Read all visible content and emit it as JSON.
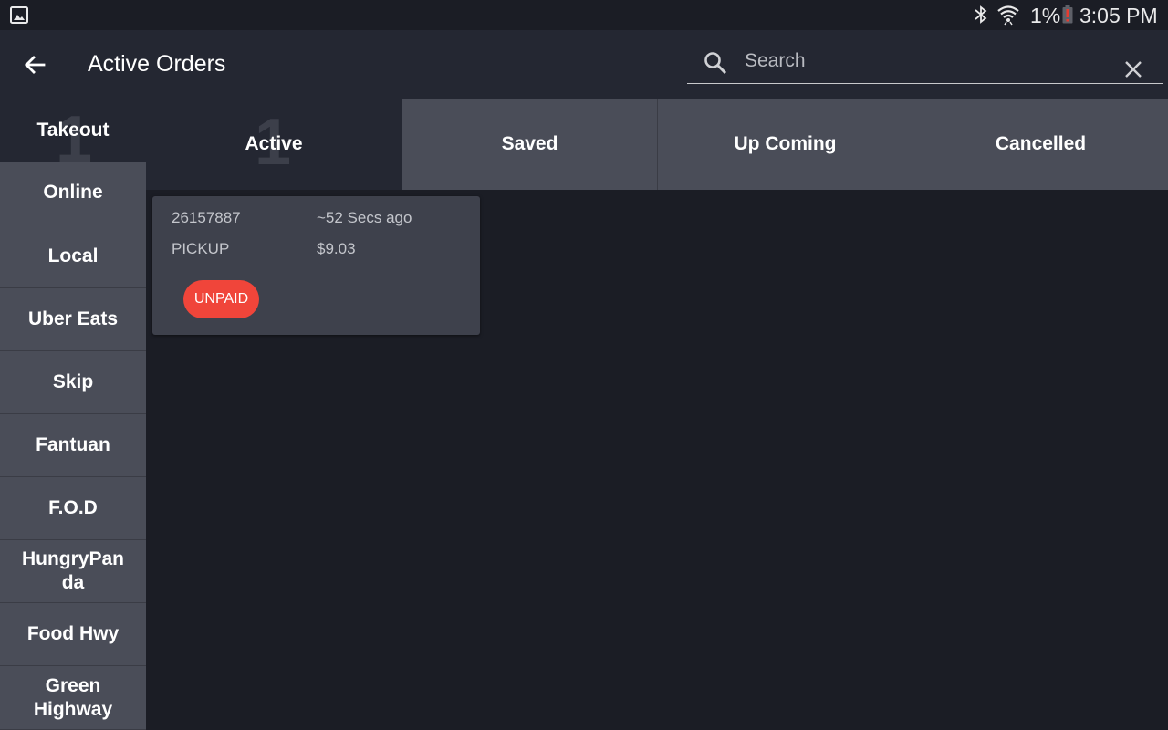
{
  "status_bar": {
    "battery": "1%",
    "time": "3:05 PM",
    "icons": [
      "gallery-icon",
      "bluetooth-icon",
      "wifi-icon",
      "battery-icon"
    ]
  },
  "header": {
    "title": "Active Orders",
    "search_placeholder": "Search",
    "search_value": ""
  },
  "sidebar": {
    "items": [
      {
        "label": "Takeout",
        "count": "1",
        "selected": true
      },
      {
        "label": "Online"
      },
      {
        "label": "Local"
      },
      {
        "label": "Uber Eats"
      },
      {
        "label": "Skip"
      },
      {
        "label": "Fantuan"
      },
      {
        "label": "F.O.D"
      },
      {
        "label": "HungryPan da"
      },
      {
        "label": "Food Hwy"
      },
      {
        "label": "Green Highway"
      }
    ]
  },
  "tabs": [
    {
      "label": "Active",
      "count": "1",
      "active": true
    },
    {
      "label": "Saved"
    },
    {
      "label": "Up Coming"
    },
    {
      "label": "Cancelled"
    }
  ],
  "orders": [
    {
      "id": "26157887",
      "time_ago": "~52 Secs ago",
      "type": "PICKUP",
      "total": "$9.03",
      "payment_status": "UNPAID"
    }
  ],
  "colors": {
    "background": "#1b1d25",
    "header": "#242732",
    "tab_inactive": "#4a4d58",
    "card": "#3e414c",
    "unpaid_badge": "#f0453a"
  }
}
